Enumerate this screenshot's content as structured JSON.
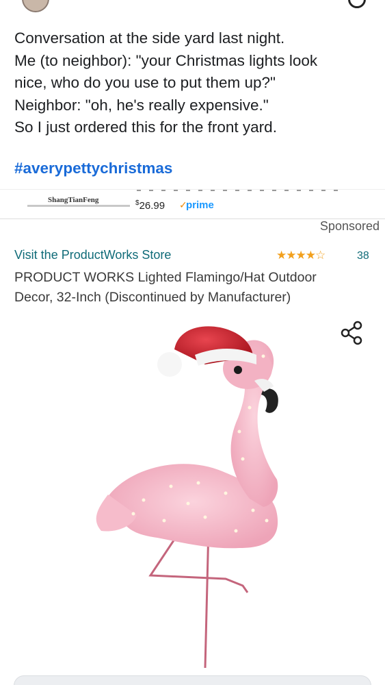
{
  "post": {
    "lines": [
      "Conversation at the side yard last night.",
      "Me (to neighbor): \"your Christmas lights look",
      "nice, who do you use to put them up?\"",
      "Neighbor: \"oh, he's really expensive.\"",
      "So I just ordered this for the front yard."
    ],
    "hashtag": "#averypettychristmas"
  },
  "ad_strip": {
    "brand": "ShangTianFeng",
    "price_symbol": "$",
    "price": "26.99",
    "prime_check": "✓",
    "prime": "prime"
  },
  "product": {
    "sponsored": "Sponsored",
    "store_link": "Visit the ProductWorks Store",
    "stars": "★★★★☆",
    "rating_count": "38",
    "title_line1": "PRODUCT WORKS Lighted Flamingo/Hat Outdoor",
    "title_line2": "Decor, 32-Inch (Discontinued by Manufacturer)",
    "rating_fraction": 0.8
  },
  "icons": {
    "share": "share-icon",
    "search": "search-icon"
  },
  "colors": {
    "hashtag": "#1a6bd8",
    "store_link": "#0f6b78",
    "stars": "#f2a01d",
    "prime": "#1a98ff",
    "flamingo": "#f4b6c6",
    "hat": "#c8202a"
  }
}
